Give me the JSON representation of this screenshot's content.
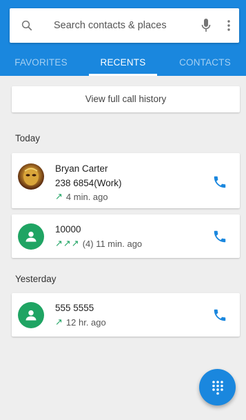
{
  "search": {
    "placeholder": "Search contacts & places",
    "icons": [
      "search-icon",
      "mic-icon",
      "more-vert-icon"
    ]
  },
  "tabs": [
    {
      "label": "FAVORITES",
      "active": false
    },
    {
      "label": "RECENTS",
      "active": true
    },
    {
      "label": "CONTACTS",
      "active": false
    }
  ],
  "history_button": "View full call history",
  "sections": {
    "today": "Today",
    "yesterday": "Yesterday"
  },
  "calls": [
    {
      "name": "Bryan Carter",
      "number": "238 6854(Work)",
      "arrows": "↗",
      "meta": "4 min. ago",
      "avatar": "photo"
    },
    {
      "name": "10000",
      "arrows": "↗↗↗",
      "meta": "(4) 11 min. ago",
      "avatar": "generic-person-icon"
    },
    {
      "name": "555 5555",
      "arrows": "↗",
      "meta": "12 hr. ago",
      "avatar": "generic-person-icon"
    }
  ],
  "colors": {
    "primary": "#1a87de",
    "avatar_green": "#1fa463",
    "outgoing_arrow": "#1fa463"
  },
  "fab_icon": "dialpad-icon"
}
